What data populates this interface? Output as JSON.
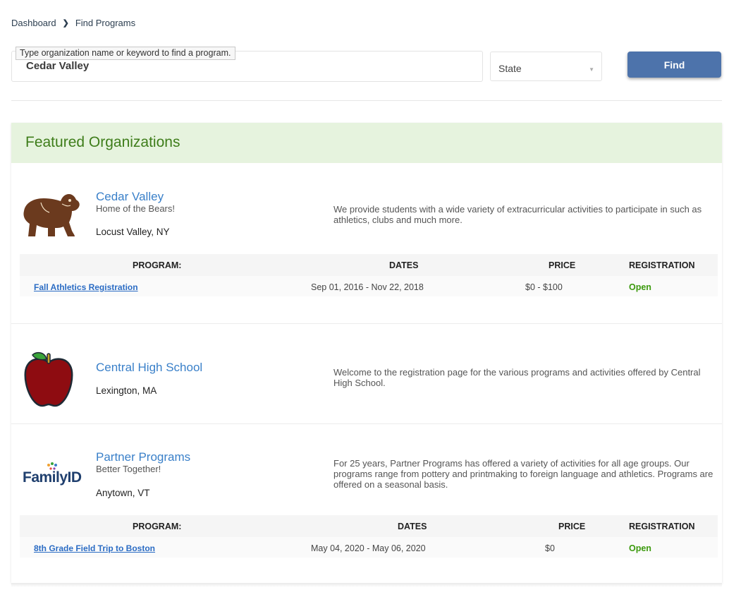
{
  "breadcrumb": {
    "home": "Dashboard",
    "current": "Find Programs"
  },
  "search": {
    "tooltip": "Type organization name or keyword to find a program.",
    "value": "Cedar Valley",
    "state_label": "State",
    "find_label": "Find"
  },
  "featured": {
    "title": "Featured Organizations",
    "table_headers": {
      "program": "PROGRAM:",
      "dates": "DATES",
      "price": "PRICE",
      "registration": "REGISTRATION"
    },
    "orgs": [
      {
        "name": "Cedar Valley",
        "tagline": "Home of the Bears!",
        "location": "Locust Valley, NY",
        "logo": "bear-icon",
        "description": "We provide students with a wide variety of extracurricular activities to participate in such as athletics, clubs and much more.",
        "programs": [
          {
            "name": "Fall Athletics Registration",
            "dates": "Sep 01, 2016 - Nov 22, 2018",
            "price": "$0 - $100",
            "status": "Open"
          }
        ]
      },
      {
        "name": "Central High School",
        "location": "Lexington, MA",
        "logo": "apple-icon",
        "description": "Welcome to the registration page for the various programs and activities offered by Central High School."
      },
      {
        "name": "Partner Programs",
        "tagline": "Better Together!",
        "location": "Anytown, VT",
        "logo": "familyid-logo",
        "logo_text": "FamilyID",
        "description": "For 25 years, Partner Programs has offered a variety of activities for all age groups. Our programs range from pottery and printmaking to foreign language and athletics. Programs are offered on a seasonal basis.",
        "programs": [
          {
            "name": "8th Grade Field Trip to Boston",
            "dates": "May 04, 2020 - May 06, 2020",
            "price": "$0",
            "status": "Open"
          }
        ]
      }
    ]
  },
  "colors": {
    "accent": "#4d73ab",
    "featured_bg": "#e6f3de",
    "featured_title": "#3e7d1a",
    "link": "#3a80c9",
    "open": "#3c9a0e"
  }
}
